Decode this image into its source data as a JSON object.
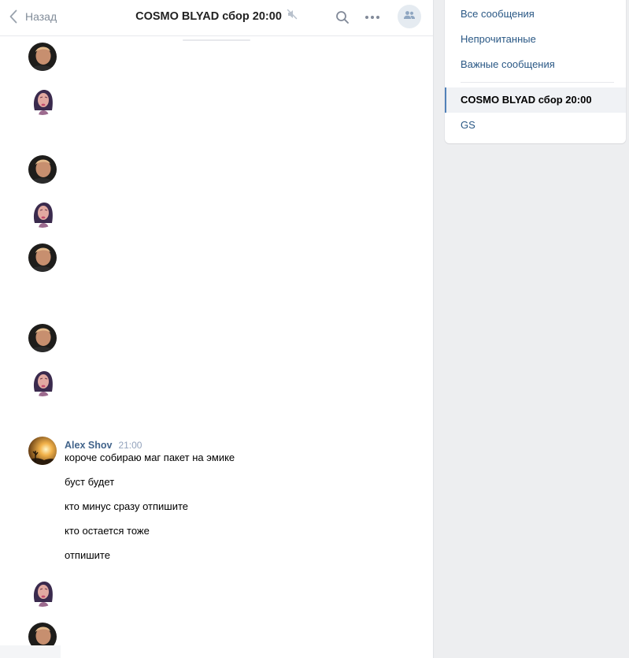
{
  "header": {
    "back_label": "Назад",
    "title": "COSMO BLYAD сбор 20:00",
    "icons": [
      "chevron-left-icon",
      "muted-speaker-icon",
      "search-icon",
      "more-icon",
      "members-icon"
    ]
  },
  "messages": {
    "author": "Alex Shov",
    "time": "21:00",
    "lines": [
      "короче собираю маг пакет на эмике",
      "буст будет",
      "кто минус сразу отпишите",
      "кто остается тоже",
      "отпишите"
    ]
  },
  "sidebar": {
    "items": [
      {
        "label": "Все сообщения"
      },
      {
        "label": "Непрочитанные"
      },
      {
        "label": "Важные сообщения"
      },
      {
        "label": "COSMO BLYAD сбор 20:00",
        "active": true
      },
      {
        "label": "GS"
      }
    ]
  },
  "colors": {
    "link": "#2a5885",
    "author": "#42648b",
    "accent": "#5181b8",
    "page_bg": "#edeef0"
  }
}
